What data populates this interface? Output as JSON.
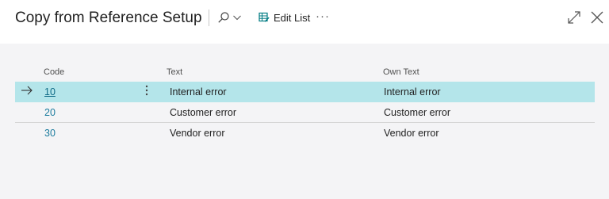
{
  "header": {
    "title": "Copy from Reference Setup",
    "edit_list_label": "Edit List",
    "more_label": "···"
  },
  "grid": {
    "columns": [
      "Code",
      "Text",
      "Own Text"
    ],
    "rows": [
      {
        "code": "10",
        "text": "Internal error",
        "own_text": "Internal error",
        "selected": true
      },
      {
        "code": "20",
        "text": "Customer error",
        "own_text": "Customer error",
        "selected": false
      },
      {
        "code": "30",
        "text": "Vendor error",
        "own_text": "Vendor error",
        "selected": false
      }
    ]
  },
  "colors": {
    "selected_row": "#b4e5ea",
    "link": "#1c7c9e",
    "accent": "#007b83"
  },
  "icons": [
    "search-icon",
    "chevron-down-icon",
    "edit-list-icon",
    "more-icon",
    "expand-icon",
    "close-icon",
    "row-arrow-icon",
    "row-menu-icon"
  ]
}
